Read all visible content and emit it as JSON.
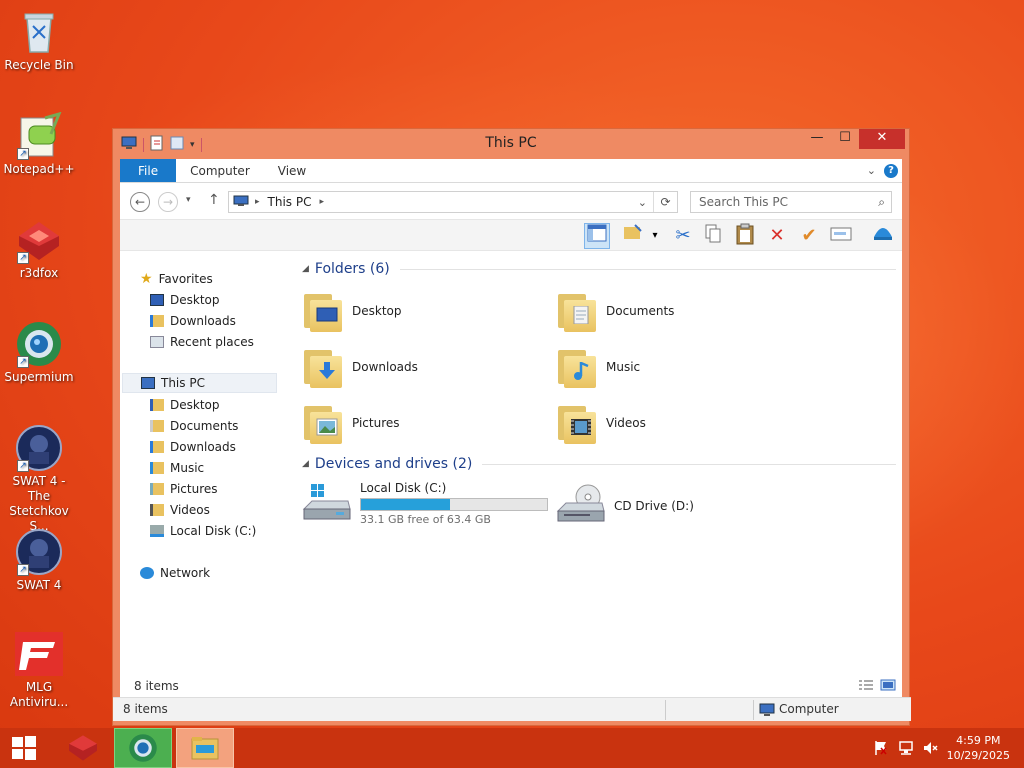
{
  "desktop": {
    "icons": [
      {
        "label": "Recycle Bin"
      },
      {
        "label": "Notepad++"
      },
      {
        "label": "r3dfox"
      },
      {
        "label": "Supermium"
      },
      {
        "label": "SWAT 4 - The Stetchkov S..."
      },
      {
        "label": "SWAT 4"
      },
      {
        "label": "MLG Antiviru..."
      }
    ]
  },
  "window": {
    "title": "This PC",
    "ribbon_tabs": [
      "File",
      "Computer",
      "View"
    ],
    "address": {
      "location": "This PC"
    },
    "search_placeholder": "Search This PC",
    "nav": {
      "favorites": "Favorites",
      "fav_items": [
        "Desktop",
        "Downloads",
        "Recent places"
      ],
      "this_pc": "This PC",
      "pc_items": [
        "Desktop",
        "Documents",
        "Downloads",
        "Music",
        "Pictures",
        "Videos",
        "Local Disk (C:)"
      ],
      "network": "Network"
    },
    "folders_header": "Folders (6)",
    "folders": [
      "Desktop",
      "Documents",
      "Downloads",
      "Music",
      "Pictures",
      "Videos"
    ],
    "devices_header": "Devices and drives (2)",
    "drives": {
      "c": {
        "name": "Local Disk (C:)",
        "free": "33.1 GB free of 63.4 GB",
        "used_fraction": 0.478
      },
      "d": {
        "name": "CD Drive (D:)"
      }
    },
    "inner_status": "8 items",
    "outer_status": "8 items",
    "computer_label": "Computer"
  },
  "taskbar": {
    "time": "4:59 PM",
    "date": "10/29/2025"
  },
  "colors": {
    "accent": "#1979ca",
    "window_frame": "#ef8a63",
    "close": "#c7302b",
    "taskbar": "#c9330f",
    "drive_fill": "#26a0da"
  }
}
